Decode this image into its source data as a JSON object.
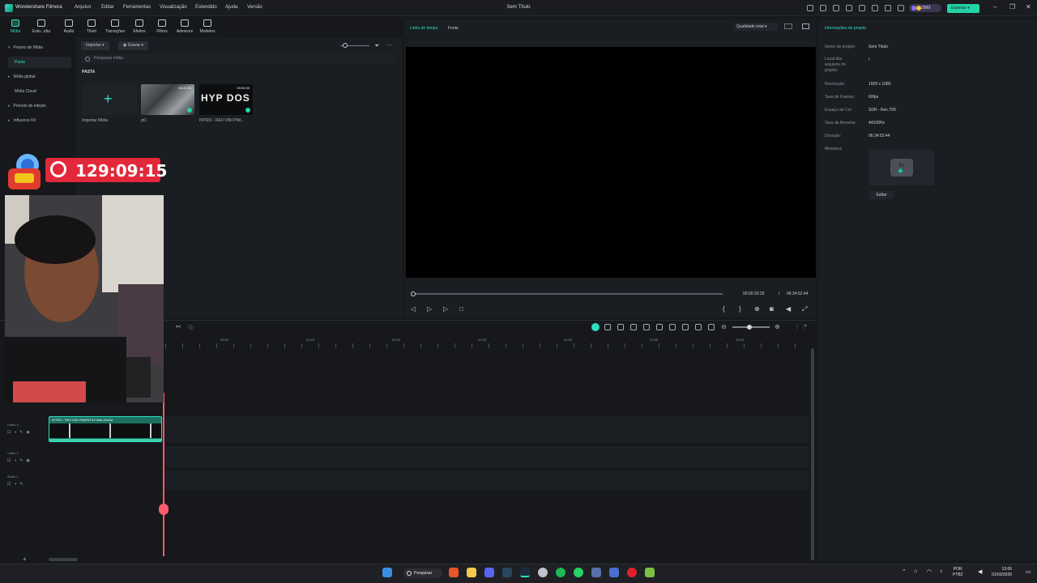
{
  "app": {
    "name": "Wondershare Filmora",
    "document_title": "Sem Título",
    "menu": [
      "Arquivo",
      "Editar",
      "Ferramentas",
      "Visualização",
      "Estendido",
      "Ajuda",
      "Versão"
    ],
    "credits": "2999",
    "export_label": "Exportar"
  },
  "toolbar": {
    "tabs": [
      {
        "label": "Mídia",
        "icon": "media-icon"
      },
      {
        "label": "Esto...idia",
        "icon": "stock-media-icon"
      },
      {
        "label": "Áudio",
        "icon": "audio-icon"
      },
      {
        "label": "Título",
        "icon": "title-icon"
      },
      {
        "label": "Transições",
        "icon": "transitions-icon"
      },
      {
        "label": "Efeitos",
        "icon": "effects-icon"
      },
      {
        "label": "Filtros",
        "icon": "filters-icon"
      },
      {
        "label": "Adesivos",
        "icon": "stickers-icon"
      },
      {
        "label": "Modelos",
        "icon": "templates-icon"
      }
    ]
  },
  "sidebar": {
    "items": [
      {
        "label": "Projeto de Mídia",
        "caret": "▾"
      },
      {
        "label": "Pasta",
        "caret": ""
      },
      {
        "label": "Mídia global",
        "caret": "▸"
      },
      {
        "label": "Mídia Cloud",
        "caret": ""
      },
      {
        "label": "Presets de edição",
        "caret": "▸"
      },
      {
        "label": "Influence Kit",
        "caret": "▸"
      }
    ]
  },
  "media": {
    "import_label": "Importar",
    "record_label": "Gravar",
    "search_placeholder": "Pesquisar mídia",
    "folder_label": "PASTA",
    "import_tile_label": "Importar Mídia",
    "items": [
      {
        "label": "pt1",
        "duration": "06:41:08"
      },
      {
        "label": "INTRO - REII VINI PIM...",
        "duration": "00:00:33",
        "thumb_text": "HYP DOS"
      }
    ]
  },
  "overlay": {
    "timer": "129:09:15"
  },
  "preview": {
    "tabs": [
      "Linha do tempo",
      "Fonte"
    ],
    "quality": "Qualidade total",
    "current_time": "00:00:33:33",
    "separator": "/",
    "total_time": "06:34:52:44",
    "progress": 0
  },
  "info": {
    "title": "Informações do projeto",
    "fields": [
      {
        "key": "Nome do projeto:",
        "value": "Sem Título"
      },
      {
        "key": "Local dos arquivos do projeto:",
        "value": "/"
      },
      {
        "key": "Resolução:",
        "value": "1920 x 1080"
      },
      {
        "key": "Taxa de Frames:",
        "value": "60fps"
      },
      {
        "key": "Espaço de Cor:",
        "value": "SDR - Rec.709"
      },
      {
        "key": "Taxa de Amostra:",
        "value": "44100Hz"
      },
      {
        "key": "Duração:",
        "value": "06:34:52:44"
      },
      {
        "key": "Miniatura:",
        "value": ""
      }
    ],
    "edit_label": "Editar"
  },
  "timeline": {
    "ruler": [
      "00:50",
      "01:15",
      "01:40",
      "02:05",
      "02:30",
      "02:55",
      "03:20"
    ],
    "tracks": [
      {
        "label": "Vídeo 2"
      },
      {
        "label": "Vídeo 1"
      },
      {
        "label": "Áudio 1"
      }
    ],
    "clip_title": "INTRO - REII VINI PIMENTA FINALIZADA",
    "zoom_level": 0.45
  },
  "taskbar": {
    "search_label": "Pesquisar",
    "lang_line1": "POR",
    "lang_line2": "PTB2",
    "time": "13:06",
    "date": "01/03/2026"
  },
  "colors": {
    "accent": "#2ce0c0",
    "timer_bg": "#e2283a",
    "playhead": "#ff5a6e"
  }
}
